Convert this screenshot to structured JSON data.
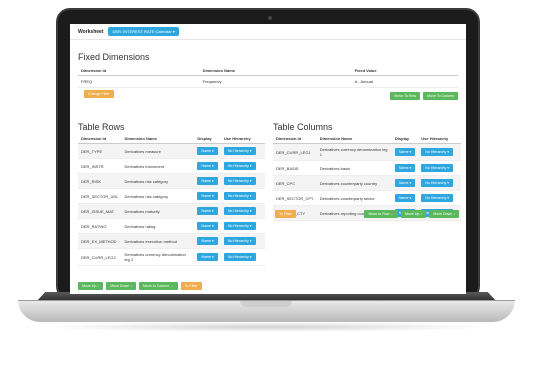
{
  "worksheet": {
    "label": "Worksheet",
    "selected": "DER: INTEREST RATE Calendar ▾"
  },
  "fixed": {
    "title": "Fixed Dimensions",
    "headers": [
      "Dimension Id",
      "Dimension Name",
      "Fixed Value"
    ],
    "rows": [
      {
        "id": "FREQ",
        "name": "Frequency",
        "value": "A - Annual"
      }
    ],
    "change_label": "Change Filter",
    "move_row_label": "Move To Row",
    "move_col_label": "Move To Column"
  },
  "rows_section": {
    "title": "Table Rows",
    "headers": [
      "Dimension Id",
      "Dimension Name",
      "Display",
      "Use Hierarchy"
    ],
    "items": [
      {
        "id": "DER_TYPE",
        "name": "Derivatives measure",
        "display": "Name ▾",
        "hier": "No Hierarchy ▾"
      },
      {
        "id": "DER_INSTR",
        "name": "Derivatives instrument",
        "display": "Name ▾",
        "hier": "No Hierarchy ▾"
      },
      {
        "id": "DER_RISK",
        "name": "Derivatives risk category",
        "display": "Name ▾",
        "hier": "No Hierarchy ▾"
      },
      {
        "id": "DER_SECTOR_UDL",
        "name": "Derivatives risk category",
        "display": "Name ▾",
        "hier": "No Hierarchy ▾"
      },
      {
        "id": "DER_ISSUE_MAT",
        "name": "Derivatives maturity",
        "display": "Name ▾",
        "hier": "No Hierarchy ▾"
      },
      {
        "id": "DER_RATING",
        "name": "Derivatives rating",
        "display": "Name ▾",
        "hier": "No Hierarchy ▾"
      },
      {
        "id": "DER_EX_METHOD",
        "name": "Derivatives execution method",
        "display": "Name ▾",
        "hier": "No Hierarchy ▾"
      },
      {
        "id": "DER_CURR_LEG2",
        "name": "Derivatives currency denomination leg 2",
        "display": "Name ▾",
        "hier": "No Hierarchy ▾"
      }
    ],
    "actions": [
      "Move Up ↑",
      "Move Down ↓",
      "Move to Column →",
      "To Filter"
    ]
  },
  "cols_section": {
    "title": "Table Columns",
    "headers": [
      "Dimension Id",
      "Dimension Name",
      "Display",
      "Use Hierarchy"
    ],
    "items": [
      {
        "id": "DER_CURR_LEG1",
        "name": "Derivatives currency denomination leg 1",
        "display": "Name ▾",
        "hier": "No Hierarchy ▾"
      },
      {
        "id": "DER_BASIS",
        "name": "Derivatives basis",
        "display": "Name ▾",
        "hier": "No Hierarchy ▾"
      },
      {
        "id": "DER_CPC",
        "name": "Derivatives counterparty country",
        "display": "Name ▾",
        "hier": "No Hierarchy ▾"
      },
      {
        "id": "DER_SECTOR_CPY",
        "name": "Derivatives counterparty sector",
        "display": "Name ▾",
        "hier": "No Hierarchy ▾"
      },
      {
        "id": "DER_REP_CTY",
        "name": "Derivatives reporting country",
        "display": "Name ▾",
        "hier": "No Hierarchy ▾"
      }
    ],
    "filter_label": "To Filter",
    "actions": [
      "Move to Row ←",
      "Move Up ↑",
      "Move Down ↓"
    ]
  },
  "colors": {
    "accent": "#2ea7e0",
    "green": "#5cb85c",
    "orange": "#f0ad4e"
  }
}
